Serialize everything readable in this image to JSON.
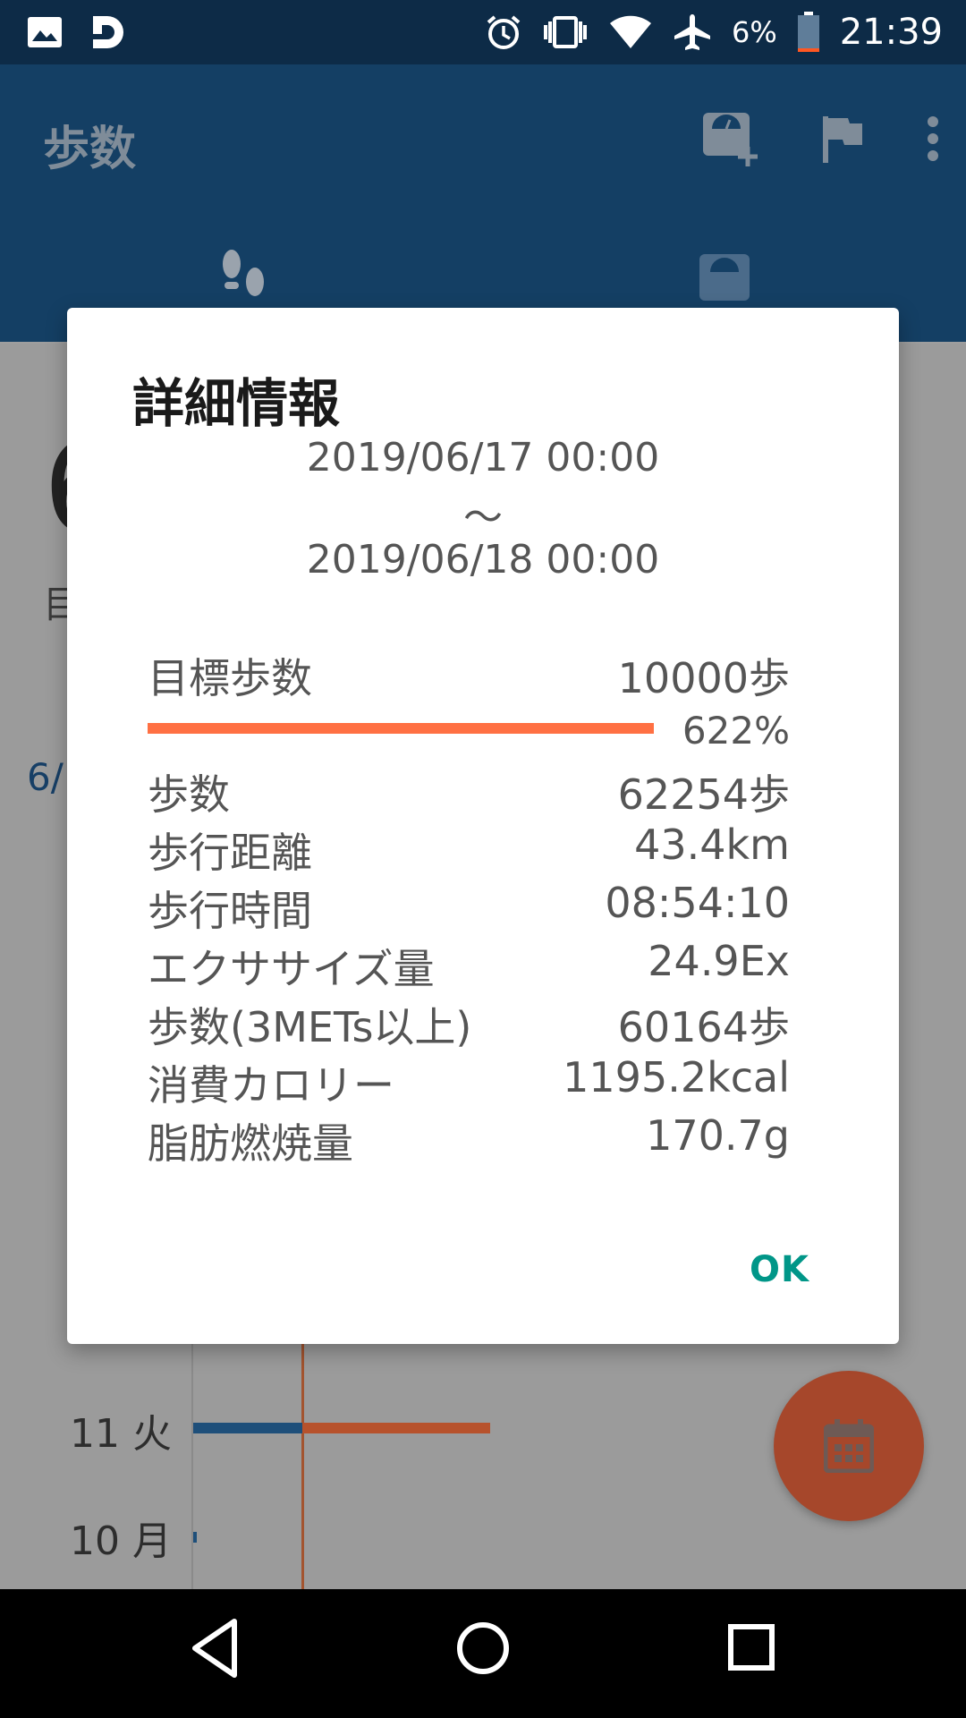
{
  "status_bar": {
    "battery_percent": "6%",
    "time": "21:39",
    "icons": [
      "image-icon",
      "d-app-icon",
      "alarm-icon",
      "vibrate-icon",
      "wifi-icon",
      "airplane-icon",
      "battery-icon"
    ]
  },
  "app_bar": {
    "title": "歩数",
    "actions": [
      "scale-add-icon",
      "flag-icon",
      "more-vert-icon"
    ],
    "tabs": [
      "footsteps-icon",
      "scale-icon"
    ]
  },
  "background": {
    "big_value": "6",
    "subtitle_fragment": "目",
    "date_fragment": "6/",
    "rows": [
      {
        "label": "11 火"
      },
      {
        "label": "10 月"
      }
    ]
  },
  "dialog": {
    "title": "詳細情報",
    "range_start": "2019/06/17 00:00",
    "range_sep": "〜",
    "range_end": "2019/06/18 00:00",
    "goal": {
      "label": "目標歩数",
      "value": "10000歩",
      "percent_text": "622%",
      "progress_fraction": 1.0
    },
    "stats": [
      {
        "label": "歩数",
        "value": "62254歩"
      },
      {
        "label": "歩行距離",
        "value": "43.4km"
      },
      {
        "label": "歩行時間",
        "value": "08:54:10"
      },
      {
        "label": "エクササイズ量",
        "value": "24.9Ex"
      },
      {
        "label": "歩数(3METs以上)",
        "value": "60164歩"
      },
      {
        "label": "消費カロリー",
        "value": "1195.2kcal"
      },
      {
        "label": "脂肪燃焼量",
        "value": "170.7g"
      }
    ],
    "ok_label": "OK"
  },
  "colors": {
    "status_bar": "#0d2b47",
    "app_bar": "#143f64",
    "progress": "#ff7043",
    "ok": "#009688",
    "fab": "#a6472b"
  }
}
